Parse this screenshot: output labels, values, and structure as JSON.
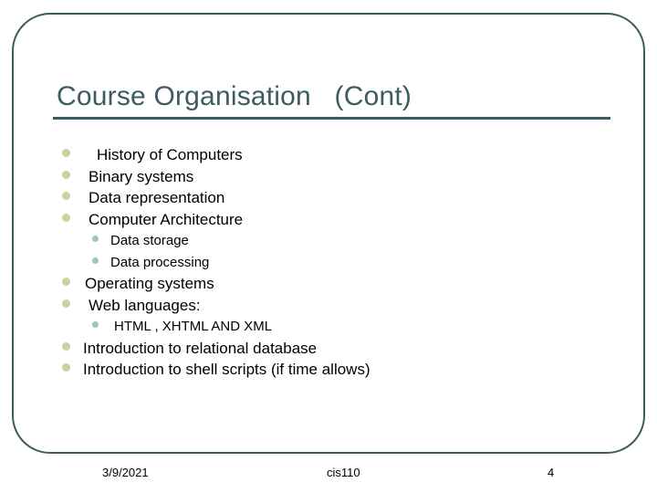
{
  "slide": {
    "title": "Course Organisation   (Cont)",
    "accent_color": "#3c5c5f",
    "bullet_color_level1": "#cecf9d",
    "bullet_color_level2": "#9fc3c4",
    "background_color": "#ffffff"
  },
  "content": {
    "items": [
      {
        "level": 1,
        "text": "History of Computers"
      },
      {
        "level": 1,
        "text": "Binary systems"
      },
      {
        "level": 1,
        "text": "Data representation"
      },
      {
        "level": 1,
        "text": "Computer Architecture"
      },
      {
        "level": 2,
        "text": "Data storage"
      },
      {
        "level": 2,
        "text": "Data processing"
      },
      {
        "level": 1,
        "text": "Operating systems"
      },
      {
        "level": 1,
        "text": "Web languages:"
      },
      {
        "level": 2,
        "text": "HTML , XHTML AND XML"
      },
      {
        "level": 1,
        "text": "Introduction to relational database"
      },
      {
        "level": 1,
        "text": "Introduction to shell scripts (if time allows)"
      }
    ]
  },
  "footer": {
    "date": "3/9/2021",
    "course": "cis110",
    "page_number": "4"
  }
}
